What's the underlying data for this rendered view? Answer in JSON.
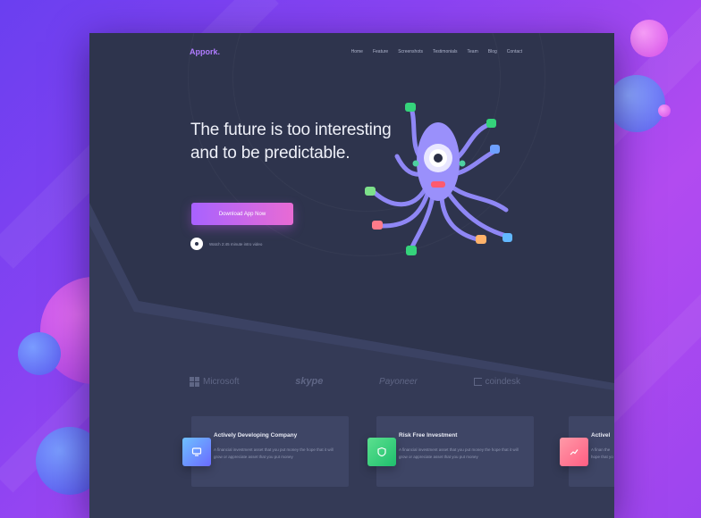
{
  "brand": {
    "logo": "Appork."
  },
  "nav": {
    "items": [
      "Home",
      "Feature",
      "Screenshots",
      "Testimonials",
      "Team",
      "Blog",
      "Contact"
    ]
  },
  "hero": {
    "headline_line1": "The future is too interesting",
    "headline_line2": "and to be predictable.",
    "cta_label": "Download App Now",
    "video_label": "Watch 2:45 minute intro video"
  },
  "partners": {
    "microsoft": "Microsoft",
    "skype": "skype",
    "payoneer": "Payoneer",
    "coindesk": "coindesk"
  },
  "cards": [
    {
      "title": "Actively Developing Company",
      "desc": "A financial investment asset that you put money the hope that it will grow or appreciate asset that you put money",
      "color": "#6a8bff"
    },
    {
      "title": "Risk Free Investment",
      "desc": "A financial investment asset that you put money the hope that it will grow or appreciate asset that you put money",
      "color": "#2ed47a"
    },
    {
      "title": "Activel",
      "desc": "A finan the hope that yo",
      "color": "#ff6f91"
    }
  ],
  "colors": {
    "accent_start": "#a862ff",
    "accent_end": "#e86bd4",
    "frame_bg": "#343a56",
    "mascot": "#8f87f5"
  },
  "icons": [
    "play-icon",
    "microsoft-logo-icon",
    "coindesk-logo-icon",
    "card-monitor-icon",
    "card-shield-icon",
    "card-chart-icon",
    "octopus-mascot"
  ]
}
